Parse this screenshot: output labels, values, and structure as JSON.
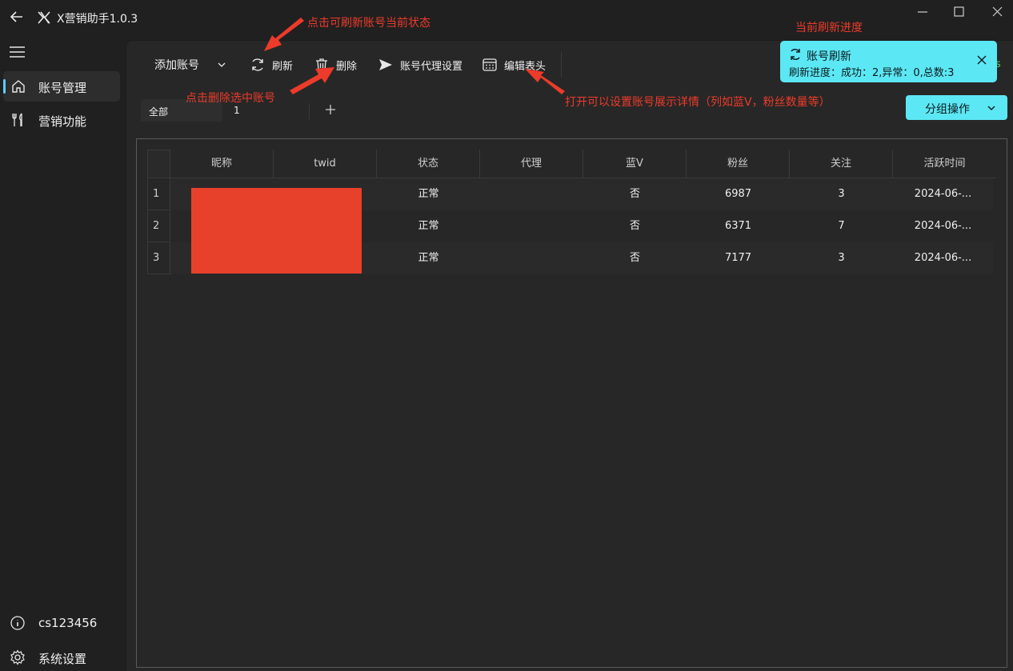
{
  "window": {
    "title": "X营销助手1.0.3"
  },
  "sidebar": {
    "items": [
      {
        "label": "账号管理",
        "icon": "home-icon",
        "active": true
      },
      {
        "label": "营销功能",
        "icon": "tools-icon",
        "active": false
      }
    ],
    "bottom": [
      {
        "label": "cs123456",
        "icon": "info-icon"
      },
      {
        "label": "系统设置",
        "icon": "gear-icon"
      }
    ]
  },
  "toolbar": {
    "add_account": "添加账号",
    "refresh": "刷新",
    "delete": "删除",
    "proxy_settings": "账号代理设置",
    "edit_header": "编辑表头"
  },
  "tabs": {
    "all": "全部",
    "group1": "1"
  },
  "group_button": "分组操作",
  "status_fragment": "s",
  "table": {
    "columns": [
      "昵称",
      "twid",
      "状态",
      "代理",
      "蓝V",
      "粉丝",
      "关注",
      "活跃时间"
    ],
    "rows": [
      {
        "index": "1",
        "nickname": "",
        "twid": "",
        "status": "正常",
        "proxy": "",
        "bluev": "否",
        "followers": "6987",
        "following": "3",
        "active_time": "2024-06-..."
      },
      {
        "index": "2",
        "nickname": "",
        "twid": "",
        "status": "正常",
        "proxy": "",
        "bluev": "否",
        "followers": "6371",
        "following": "7",
        "active_time": "2024-06-..."
      },
      {
        "index": "3",
        "nickname": "",
        "twid": "",
        "status": "正常",
        "proxy": "",
        "bluev": "否",
        "followers": "7177",
        "following": "3",
        "active_time": "2024-06-..."
      }
    ]
  },
  "toast": {
    "title": "账号刷新",
    "body": "刷新进度：成功：2,异常：0,总数:3"
  },
  "annotations": {
    "refresh": "点击可刷新账号当前状态",
    "delete": "点击删除选中账号",
    "edit_header": "打开可以设置账号展示详情（列如蓝V，粉丝数量等）",
    "progress": "当前刷新进度"
  },
  "colors": {
    "accent": "#5ce7f4",
    "annotation": "#ec3b2a",
    "redaction": "#e8412b",
    "background": "#202020",
    "panel": "#272727"
  }
}
